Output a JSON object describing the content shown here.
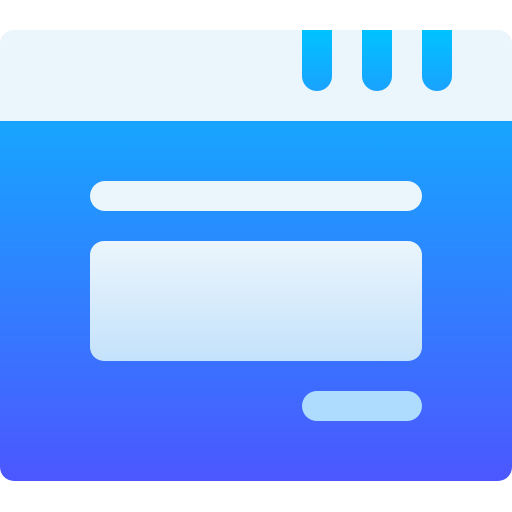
{
  "icon": {
    "name": "browser-window-icon",
    "colors": {
      "titlebar": "#EBF5FC",
      "body_gradient_top": "#17A5FF",
      "body_gradient_bottom": "#4C57FF",
      "tab_gradient_top": "#00C3FF",
      "tab_gradient_bottom": "#1AA2FF",
      "line_bar": "#EBF5FC",
      "panel_gradient_top": "#EBF5FC",
      "panel_gradient_bottom": "#C4E2FB",
      "pill": "#ADDCFF"
    }
  }
}
